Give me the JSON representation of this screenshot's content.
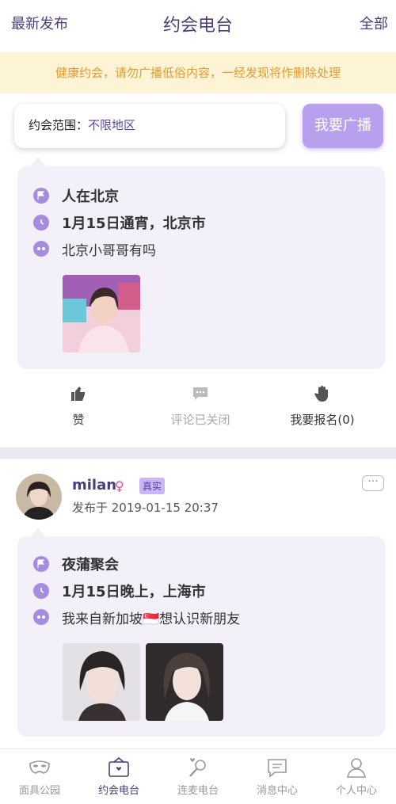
{
  "header": {
    "left_label": "最新发布",
    "title": "约会电台",
    "right_label": "全部"
  },
  "notice": "健康约会，请勿广播低俗内容，一经发现将作删除处理",
  "filter": {
    "label": "约会范围：",
    "value": "不限地区",
    "broadcast_button": "我要广播"
  },
  "post1": {
    "title": "人在北京",
    "time_place": "1月15日通宵，北京市",
    "message": "北京小哥哥有吗",
    "actions": {
      "like": "赞",
      "comments": "评论已关闭",
      "signup": "我要报名(0)"
    }
  },
  "post2": {
    "username": "milan",
    "gender_symbol": "♀",
    "verified_badge": "真实",
    "published": "发布于 2019-01-15 20:37",
    "more": "···",
    "title": "夜蒲聚会",
    "time_place": "1月15日晚上，上海市",
    "message": "我来自新加坡🇸🇬想认识新朋友"
  },
  "tabs": [
    {
      "label": "面具公园",
      "icon": "mask-icon"
    },
    {
      "label": "约会电台",
      "icon": "radio-icon"
    },
    {
      "label": "连麦电台",
      "icon": "microphone-icon"
    },
    {
      "label": "消息中心",
      "icon": "message-icon"
    },
    {
      "label": "个人中心",
      "icon": "person-icon"
    }
  ],
  "colors": {
    "brand": "#4a3d7a",
    "accent": "#b8a0ee",
    "notice_text": "#e59a2b",
    "notice_bg": "#fdf4d6",
    "card_bg": "#f4f0fa"
  }
}
